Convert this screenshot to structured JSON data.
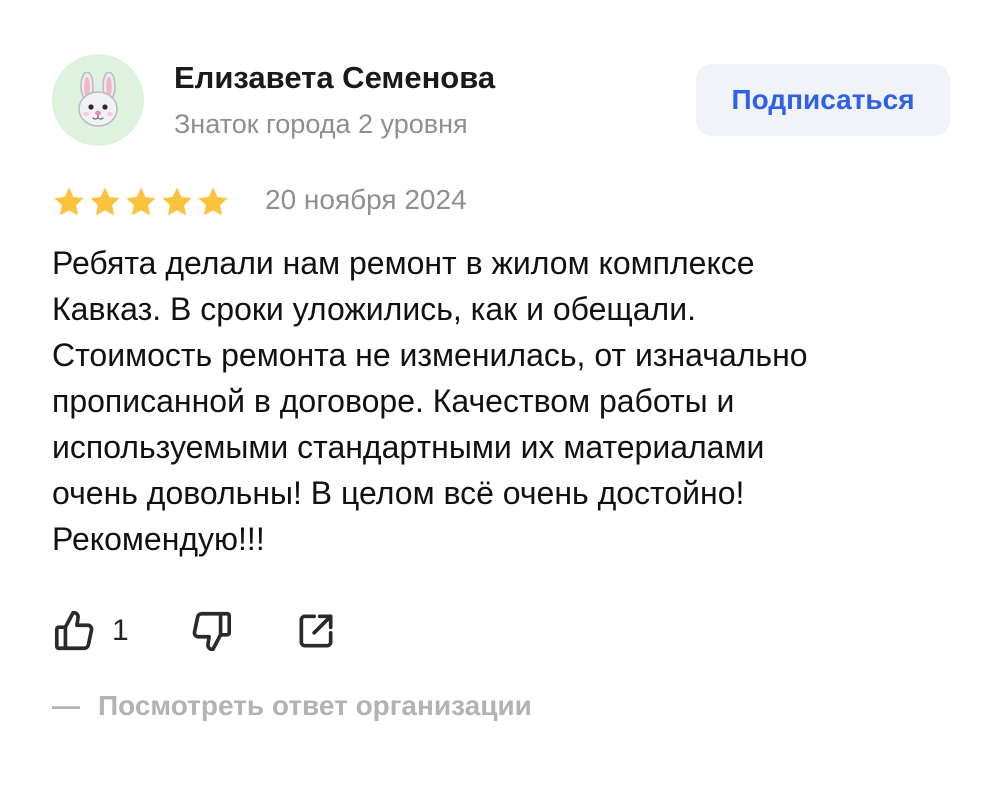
{
  "author": {
    "name": "Елизавета Семенова",
    "level": "Знаток города 2 уровня",
    "avatar_icon": "rabbit-face-icon"
  },
  "subscribe": {
    "label": "Подписаться",
    "color": "#2f60e8"
  },
  "review": {
    "rating": 5,
    "rating_max": 5,
    "star_color": "#fcc43e",
    "date": "20 ноября 2024",
    "text_lines": [
      "Ребята делали нам ремонт в жилом комплексе",
      "Кавказ. В сроки уложились, как и обещали.",
      "Стоимость ремонта не изменилась, от изначально",
      "прописанной в договоре. Качеством работы и",
      "используемыми стандартными их материалами",
      "очень довольны! В целом всё очень достойно!",
      "Рекомендую!!!"
    ]
  },
  "actions": {
    "like_icon": "thumbs-up-icon",
    "like_count": "1",
    "dislike_icon": "thumbs-down-icon",
    "share_icon": "share-icon"
  },
  "org_reply": {
    "dash": "—",
    "label": "Посмотреть ответ организации"
  }
}
